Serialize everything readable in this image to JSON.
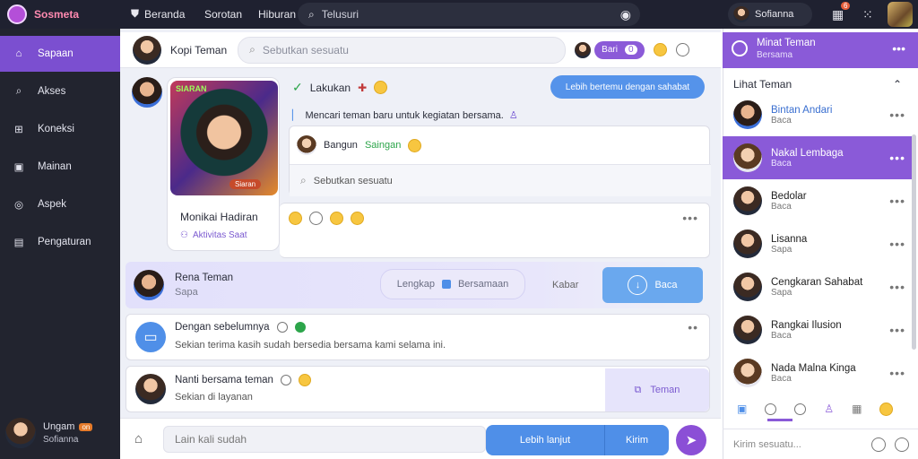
{
  "app": {
    "name": "Sosmeta"
  },
  "topnav": {
    "tabs": [
      "Beranda",
      "Sorotan",
      "Hiburan"
    ],
    "search_placeholder": "Telusuri",
    "user_name": "Sofianna",
    "notif_count": "6"
  },
  "sidebar": {
    "items": [
      {
        "label": "Sapaan",
        "icon": "home-icon"
      },
      {
        "label": "Akses",
        "icon": "search-icon"
      },
      {
        "label": "Koneksi",
        "icon": "grid-icon"
      },
      {
        "label": "Mainan",
        "icon": "controller-icon"
      },
      {
        "label": "Aspek",
        "icon": "compass-icon"
      },
      {
        "label": "Pengaturan",
        "icon": "gallery-icon"
      }
    ],
    "profile": {
      "name": "Ungam",
      "sub": "Sofianna",
      "badge": "on"
    }
  },
  "chat": {
    "header_title": "Kopi Teman",
    "search_placeholder": "Sebutkan sesuatu",
    "header_pill": "Bari",
    "header_pill_count": "0",
    "post_card_badge": "SIARAN",
    "post_card_title": "Monikai Hadiran",
    "post_card_sub": "Aktivitas Saat",
    "post_image_label": "Siaran",
    "line1": "Lakukan",
    "line1_btn": "Lebih bertemu dengan sahabat",
    "line2": "Mencari teman baru untuk kegiatan bersama.",
    "line3_name": "Bangun",
    "line3_status": "Saingan",
    "inner_search": "Sebutkan sesuatu",
    "contact_name": "Rena Teman",
    "contact_sub": "Sapa",
    "contact_btn1": "Lengkap",
    "contact_btn2": "Bersamaan",
    "contact_btn3": "Kabar",
    "contact_btn4": "Baca",
    "msg2_title": "Dengan sebelumnya",
    "msg2_body": "Sekian terima kasih sudah bersedia bersama kami selama ini.",
    "msg3_title": "Nanti bersama teman",
    "msg3_body": "Sekian di layanan",
    "msg3_btn": "Teman",
    "composer_placeholder": "Lain kali sudah",
    "composer_btn1": "Lebih lanjut",
    "composer_btn2": "Kirim"
  },
  "right": {
    "title": "Minat Teman",
    "subtitle": "Bersama",
    "list_title": "Lihat Teman",
    "footer_placeholder": "Kirim sesuatu...",
    "items": [
      {
        "name": "Bintan Andari",
        "sub": "Baca"
      },
      {
        "name": "Nakal Lembaga",
        "sub": "Baca"
      },
      {
        "name": "Bedolar",
        "sub": "Baca"
      },
      {
        "name": "Lisanna",
        "sub": "Sapa"
      },
      {
        "name": "Cengkaran Sahabat",
        "sub": "Sapa"
      },
      {
        "name": "Rangkai Ilusion",
        "sub": "Baca"
      },
      {
        "name": "Nada Malna Kinga",
        "sub": "Baca"
      }
    ]
  },
  "colors": {
    "accent": "#7b4fd0",
    "blue": "#4f8fe8",
    "sidebar": "#22242f"
  }
}
